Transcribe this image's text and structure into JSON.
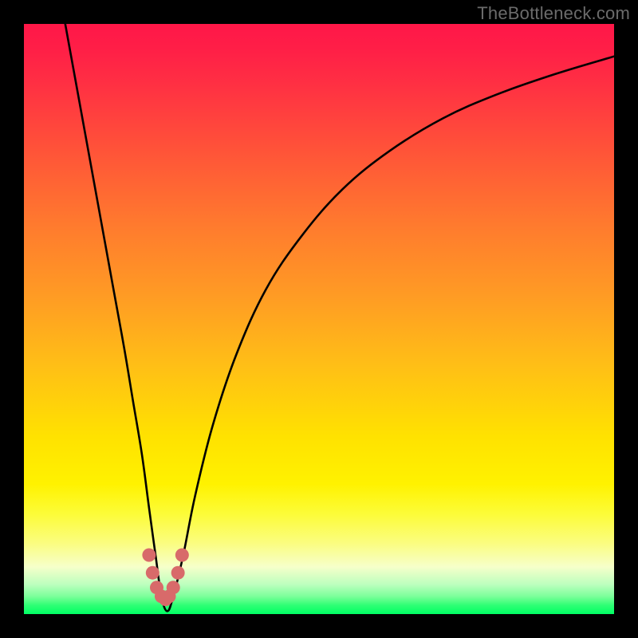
{
  "watermark": "TheBottleneck.com",
  "colors": {
    "page_bg": "#000000",
    "curve": "#000000",
    "marker_fill": "#d86a6a",
    "marker_stroke": "#c85858"
  },
  "chart_data": {
    "type": "line",
    "title": "",
    "xlabel": "",
    "ylabel": "",
    "xlim": [
      0,
      100
    ],
    "ylim": [
      0,
      100
    ],
    "series": [
      {
        "name": "bottleneck-curve",
        "x": [
          7,
          9,
          11,
          13,
          15,
          17,
          18.5,
          20,
          21.2,
          22.3,
          23.3,
          24.3,
          25.3,
          27,
          29,
          32,
          36,
          41,
          47,
          54,
          62,
          71,
          80,
          90,
          100
        ],
        "y": [
          100,
          89,
          78,
          67,
          56,
          45,
          36,
          27,
          18,
          10,
          3,
          0.5,
          3,
          10,
          20,
          32,
          44,
          55,
          64,
          72,
          78.5,
          84,
          88,
          91.5,
          94.5
        ]
      }
    ],
    "markers": {
      "name": "highlight-dots",
      "points": [
        {
          "x": 21.2,
          "y": 10.0
        },
        {
          "x": 21.8,
          "y": 7.0
        },
        {
          "x": 22.5,
          "y": 4.5
        },
        {
          "x": 23.3,
          "y": 3.0
        },
        {
          "x": 24.0,
          "y": 2.5
        },
        {
          "x": 24.6,
          "y": 3.0
        },
        {
          "x": 25.3,
          "y": 4.5
        },
        {
          "x": 26.1,
          "y": 7.0
        },
        {
          "x": 26.8,
          "y": 10.0
        }
      ]
    },
    "background_gradient": {
      "orientation": "vertical",
      "stops": [
        {
          "pos": 0.0,
          "color": "#ff1748"
        },
        {
          "pos": 0.5,
          "color": "#ffb018"
        },
        {
          "pos": 0.8,
          "color": "#fff200"
        },
        {
          "pos": 1.0,
          "color": "#00ff64"
        }
      ]
    }
  }
}
